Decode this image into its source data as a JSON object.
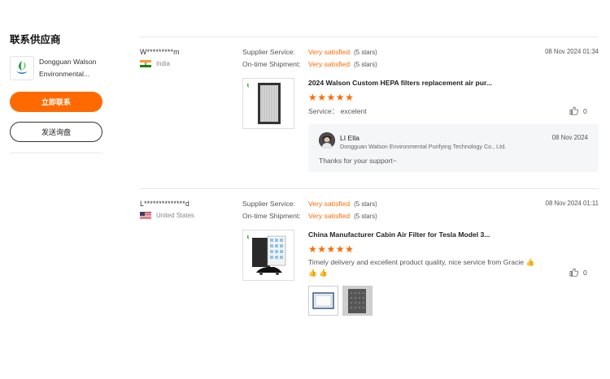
{
  "sidebar": {
    "title": "联系供应商",
    "supplier_name_line1": "Dongguan Walson",
    "supplier_name_line2": "Environmental...",
    "contact_button": "立即联系",
    "inquiry_button": "发送询盘"
  },
  "reviews": [
    {
      "buyer": "W*********m",
      "country": "India",
      "supplier_service_label": "Supplier Service:",
      "supplier_service_value": "Very satisfied",
      "supplier_service_stars": "(5 stars)",
      "shipment_label": "On-time Shipment:",
      "shipment_value": "Very satisfied",
      "shipment_stars": "(5 stars)",
      "date": "08 Nov 2024 01:34",
      "product_title": "2024 Walson Custom HEPA filters replacement air pur...",
      "rating": 5,
      "service_text": "Service： excelent",
      "likes": "0",
      "reply": {
        "name": "LI Ella",
        "company": "Dongguan Walson Environmental Purifying Technology Co., Ltd.",
        "date": "08 Nov 2024",
        "text": "Thanks for your support~"
      }
    },
    {
      "buyer": "L**************d",
      "country": "United States",
      "supplier_service_label": "Supplier Service:",
      "supplier_service_value": "Very satisfied",
      "supplier_service_stars": "(5 stars)",
      "shipment_label": "On-time Shipment:",
      "shipment_value": "Very satisfied",
      "shipment_stars": "(5 stars)",
      "date": "08 Nov 2024 01:11",
      "product_title": "China Manufacturer Cabin Air Filter for Tesla Model 3...",
      "rating": 5,
      "comment_line1": "Timely delivery and excellent product quality, nice service from Gracie 👍",
      "comment_line2": "👍 👍",
      "likes": "0"
    }
  ],
  "colors": {
    "accent": "#ff6a00",
    "divider": "#e8e8e8"
  },
  "icons": [
    "supplier-logo-icon",
    "india-flag-icon",
    "us-flag-icon",
    "thumbs-up-icon",
    "star-icon"
  ]
}
